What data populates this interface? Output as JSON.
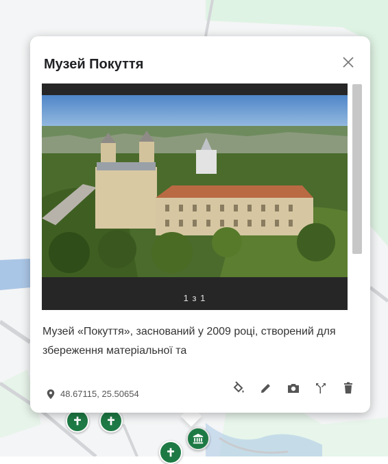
{
  "popup": {
    "title": "Музей Покуття",
    "gallery_counter": "1 з 1",
    "description": "Музей «Покуття», заснований у 2009 році, створений для збереження матеріальної та",
    "coordinates": "48.67115, 25.50654",
    "actions": [
      "fill-bucket-icon",
      "pencil-icon",
      "camera-icon",
      "route-icon",
      "trash-icon"
    ]
  },
  "markers": [
    "church-marker",
    "church-marker",
    "museum-marker",
    "church-marker"
  ],
  "colors": {
    "marker_green": "#1e7a44",
    "map_water": "#aac6e6",
    "map_green": "#dff3e4",
    "icon_gray": "#555555"
  }
}
